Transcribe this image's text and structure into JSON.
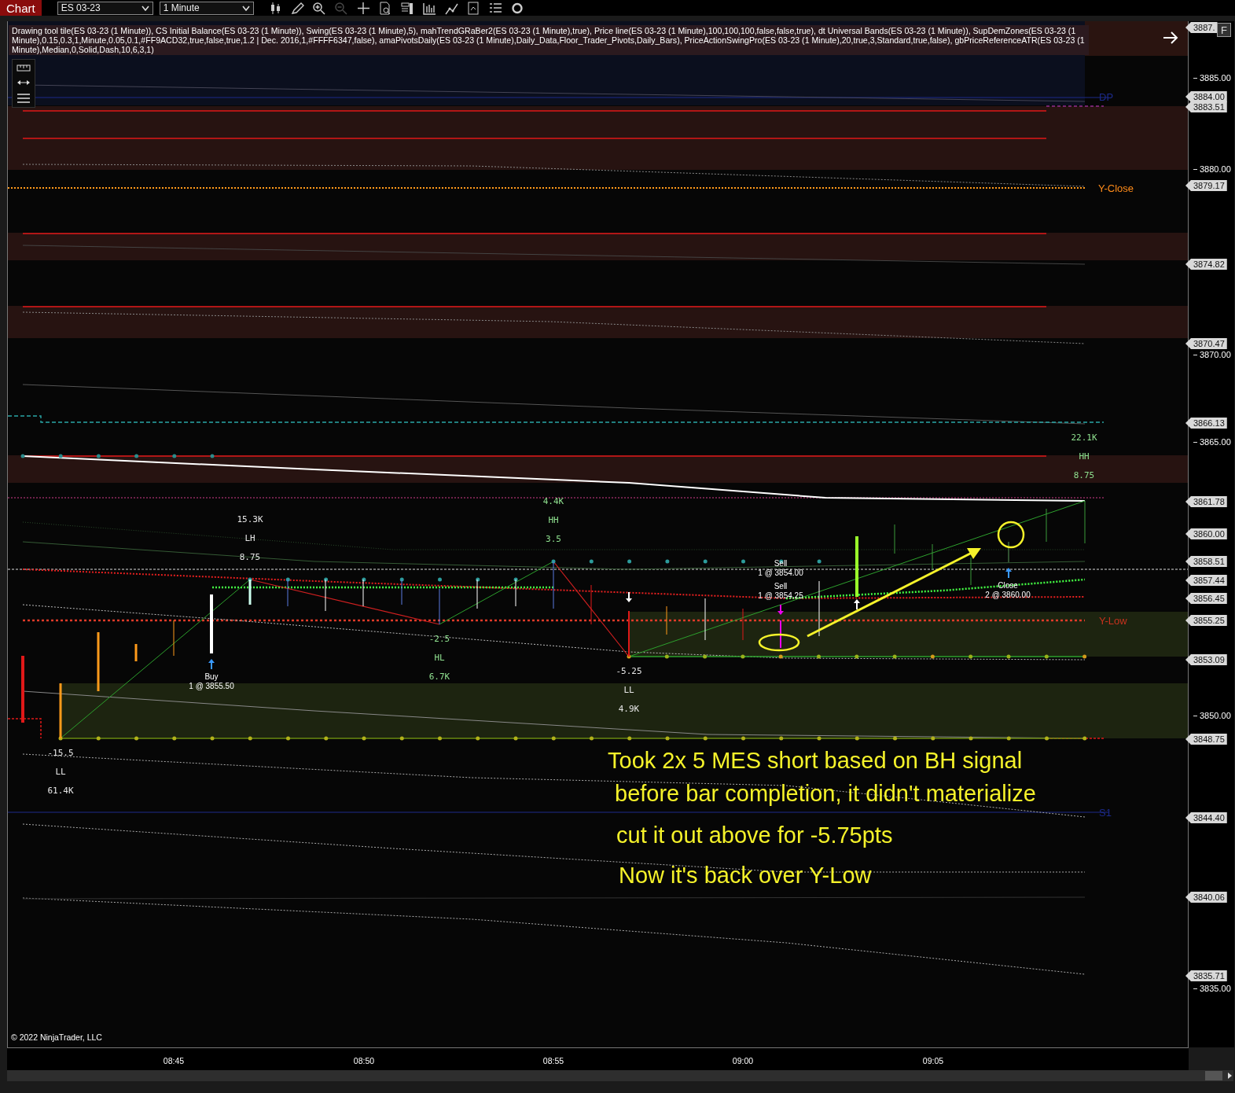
{
  "top_bar": {
    "tab": "Chart",
    "instrument": "ES 03-23",
    "interval": "1 Minute",
    "toolbar": [
      {
        "disabled": false
      },
      {
        "disabled": false
      },
      {
        "disabled": false
      },
      {
        "disabled": true
      },
      {
        "disabled": false
      },
      {
        "disabled": false
      },
      {
        "disabled": false
      },
      {
        "disabled": false
      },
      {
        "disabled": false
      },
      {
        "disabled": false
      },
      {
        "disabled": false
      },
      {
        "disabled": false
      }
    ]
  },
  "chart": {
    "indicators": "Drawing tool tile(ES 03-23 (1 Minute)), CS Initial Balance(ES 03-23 (1 Minute)), Swing(ES 03-23 (1 Minute),5), mahTrendGRaBer2(ES 03-23 (1 Minute),true), Price line(ES 03-23 (1 Minute),100,100,100,false,false,true), dt Universal Bands(ES 03-23 (1 Minute)), SupDemZones(ES 03-23 (1 Minute),0.15,0.3,1,Minute,0.05,0.1,#FF9ACD32,true,false,true,1.2 | Dec. 2016,1,#FFFF6347,false), amaPivotsDaily(ES 03-23 (1 Minute),Daily_Data,Floor_Trader_Pivots,Daily_Bars), PriceActionSwingPro(ES 03-23 (1 Minute),20,true,3,Standard,true,false), gbPriceReferenceATR(ES 03-23 (1 Minute),Median,0,Solid,Dash,10,6,3,1)",
    "level_labels": [
      {
        "text": "DP",
        "color": "#1c2a8a"
      },
      {
        "text": "Y-Close",
        "color": "#ff8c1a"
      },
      {
        "text": "Y-Low",
        "color": "#c8321e"
      },
      {
        "text": "S1",
        "color": "#1c2a8a"
      }
    ],
    "swing_labels": [
      {
        "lines": [
          "22.1K",
          "HH",
          "8.75"
        ],
        "color": "#8fe08f"
      },
      {
        "lines": [
          "15.3K",
          "LH",
          "8.75"
        ],
        "color": "#e6e6e6"
      },
      {
        "lines": [
          "4.4K",
          "HH",
          "3.5"
        ],
        "color": "#8fe08f"
      },
      {
        "lines": [
          "-2.5",
          "HL",
          "6.7K"
        ],
        "color": "#8fe08f"
      },
      {
        "lines": [
          "-5.25",
          "LL",
          "4.9K"
        ],
        "color": "#e6e6e6"
      },
      {
        "lines": [
          "-15.5",
          "LL",
          "61.4K"
        ],
        "color": "#e6e6e6"
      }
    ],
    "trades": [
      {
        "action": "Buy",
        "fill": "1 @ 3855.50"
      },
      {
        "action": "Sell",
        "fill": "1 @ 3854.00"
      },
      {
        "action": "Sell",
        "fill": "1 @ 3854.25"
      },
      {
        "action": "Close",
        "fill": "2 @ 3860.00"
      }
    ],
    "note_lines": [
      "Took 2x 5 MES short based on BH signal",
      "before bar completion, it didn't materialize",
      "cut it out above for -5.75pts",
      "Now it's back over Y-Low"
    ],
    "copyright": "© 2022 NinjaTrader, LLC"
  },
  "price_axis": {
    "ticks": [
      "3885.00",
      "3880.00",
      "3870.00",
      "3865.00",
      "3850.00",
      "3835.00"
    ],
    "markers": [
      "3887.",
      "3884.00",
      "3883.51",
      "3879.17",
      "3874.82",
      "3870.47",
      "3866.13",
      "3861.78",
      "3860.00",
      "3858.51",
      "3857.44",
      "3856.45",
      "3855.25",
      "3853.09",
      "3848.75",
      "3844.40",
      "3840.06",
      "3835.71"
    ],
    "button": "F"
  },
  "time_axis": [
    "08:45",
    "08:50",
    "08:55",
    "09:00",
    "09:05"
  ]
}
